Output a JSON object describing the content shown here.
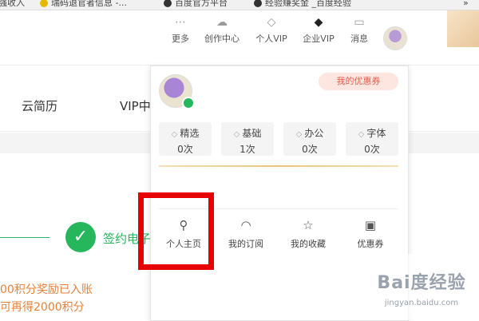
{
  "bookmarks": [
    {
      "label": "强收入",
      "icon": "bookmark-icon"
    },
    {
      "label": "瑞码退官者信息 -...",
      "icon": "bookmark-icon"
    },
    {
      "label": "百度官方平台",
      "icon": "bookmark-icon"
    },
    {
      "label": "经验赚奖金 _百度经验",
      "icon": "bookmark-icon"
    }
  ],
  "bookmark_overflow": "»",
  "header": {
    "nav": [
      {
        "label": "更多",
        "icon": "more-dots-icon"
      },
      {
        "label": "创作中心",
        "icon": "cloud-upload-icon"
      },
      {
        "label": "个人VIP",
        "icon": "diamond-icon"
      },
      {
        "label": "企业VIP",
        "icon": "diamond-crown-icon"
      },
      {
        "label": "消息",
        "icon": "message-icon"
      }
    ]
  },
  "subnav": {
    "items": [
      "云简历",
      "VIP中"
    ]
  },
  "panel": {
    "coupon_label": "我的优惠券",
    "quotas": [
      {
        "name": "精选",
        "count": "0次"
      },
      {
        "name": "基础",
        "count": "1次"
      },
      {
        "name": "办公",
        "count": "0次"
      },
      {
        "name": "字体",
        "count": "0次"
      }
    ],
    "actions": [
      {
        "label": "个人主页",
        "icon": "person-icon"
      },
      {
        "label": "我的订阅",
        "icon": "rss-icon"
      },
      {
        "label": "我的收藏",
        "icon": "star-icon"
      },
      {
        "label": "优惠券",
        "icon": "ticket-icon"
      }
    ]
  },
  "content": {
    "step_label": "签约电子",
    "reward_line1": "00积分奖励已入账",
    "reward_line2": "可再得2000积分"
  },
  "watermark": {
    "brand": "Bai度经验",
    "url": "jingyan.baidu.com"
  },
  "colors": {
    "accent_green": "#26b65c",
    "highlight_red": "#e60000",
    "reward_orange": "#e8823a",
    "coupon_pink": "#fde6df"
  }
}
